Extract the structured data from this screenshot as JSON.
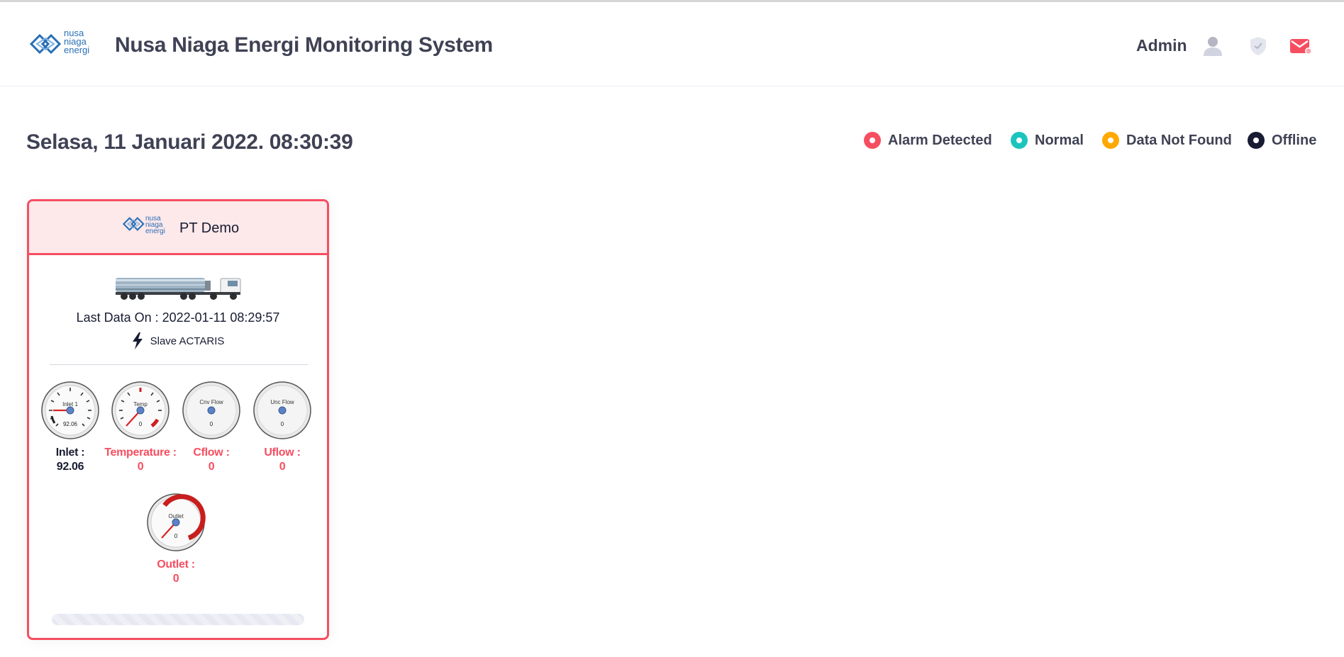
{
  "header": {
    "logo_text": [
      "nusa",
      "niaga",
      "energi"
    ],
    "title": "Nusa Niaga Energi Monitoring System",
    "user_name": "Admin",
    "icons": [
      "user-icon",
      "shield-check-icon",
      "mail-icon"
    ]
  },
  "datetime": "Selasa, 11 Januari 2022. 08:30:39",
  "legend": [
    {
      "label": "Alarm Detected",
      "color": "#f64e60"
    },
    {
      "label": "Normal",
      "color": "#1bc5bd"
    },
    {
      "label": "Data Not Found",
      "color": "#ffa800"
    },
    {
      "label": "Offline",
      "color": "#181c32"
    }
  ],
  "card": {
    "name": "PT Demo",
    "status_color": "#f64e60",
    "last_data": "Last Data On : 2022-01-11 08:29:57",
    "slave": "Slave ACTARIS",
    "gauges": [
      {
        "key": "inlet",
        "dial_label": "Inlet 1",
        "dial_value": "92.06",
        "label": "Inlet :",
        "value": "92.06",
        "status": "normal"
      },
      {
        "key": "temp",
        "dial_label": "Temp",
        "dial_value": "0",
        "label": "Temperature :",
        "value": "0",
        "status": "alarm"
      },
      {
        "key": "cflow",
        "dial_label": "Cnv Flow",
        "dial_value": "0",
        "label": "Cflow :",
        "value": "0",
        "status": "alarm"
      },
      {
        "key": "uflow",
        "dial_label": "Unc Flow",
        "dial_value": "0",
        "label": "Uflow :",
        "value": "0",
        "status": "alarm"
      },
      {
        "key": "outlet",
        "dial_label": "Outlet",
        "dial_value": "0",
        "label": "Outlet :",
        "value": "0",
        "status": "alarm"
      }
    ]
  },
  "colors": {
    "alarm": "#f64e60",
    "text_dark": "#3f4254",
    "brand_blue": "#2a6fb5"
  }
}
